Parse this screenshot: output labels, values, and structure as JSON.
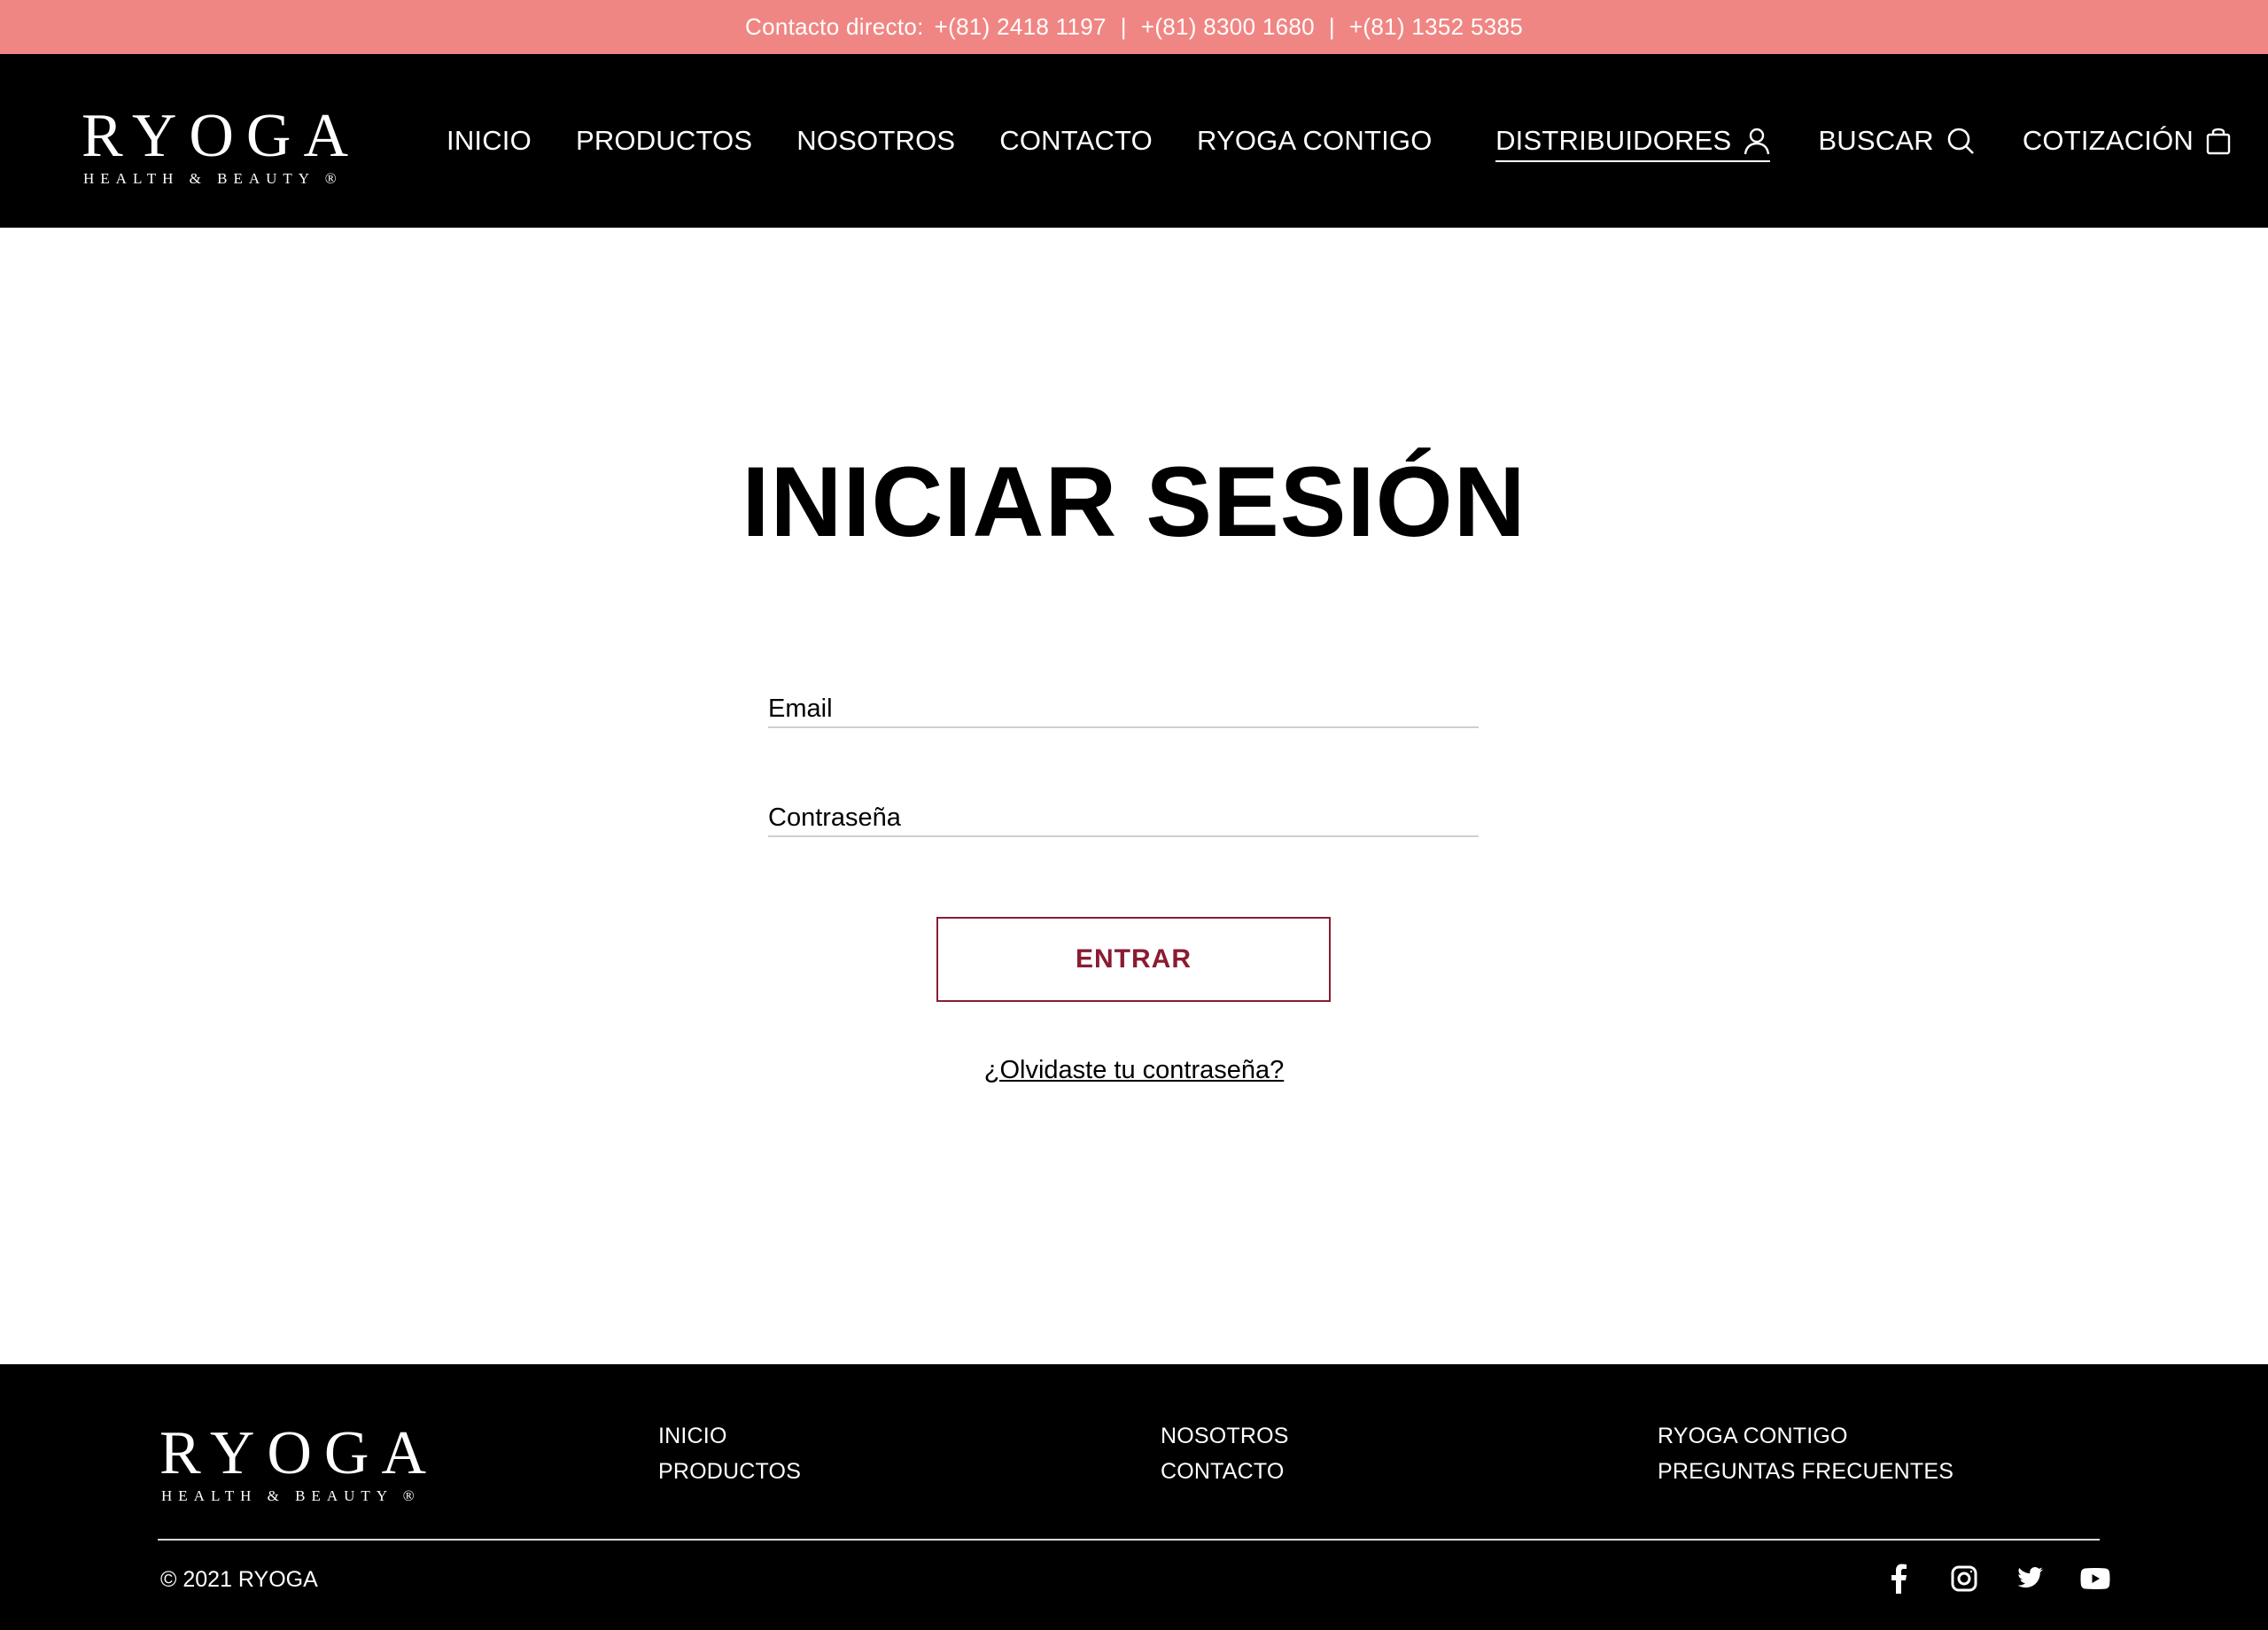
{
  "topbar": {
    "label": "Contacto directo:",
    "phones": [
      "+(81) 2418 1197",
      "+(81) 8300 1680",
      "+(81) 1352 5385"
    ],
    "separator": "|",
    "bg_color": "#f08683"
  },
  "header": {
    "logo_word": "RYOGA",
    "logo_sub": "HEALTH & BEAUTY ®",
    "nav": [
      "INICIO",
      "PRODUCTOS",
      "NOSOTROS",
      "CONTACTO",
      "RYOGA CONTIGO"
    ],
    "distribuidores": "DISTRIBUIDORES",
    "buscar": "BUSCAR",
    "cotizacion": "COTIZACIÓN",
    "icons": {
      "distribuidores": "user-icon",
      "buscar": "search-icon",
      "cotizacion": "bag-icon"
    }
  },
  "login": {
    "title": "INICIAR SESIÓN",
    "email_placeholder": "Email",
    "password_placeholder": "Contraseña",
    "submit_label": "ENTRAR",
    "forgot_label": "¿Olvidaste tu contraseña?",
    "accent_color": "#8a1c33"
  },
  "footer": {
    "logo_word": "RYOGA",
    "logo_sub": "HEALTH & BEAUTY ®",
    "col1": [
      "INICIO",
      "PRODUCTOS"
    ],
    "col2": [
      "NOSOTROS",
      "CONTACTO"
    ],
    "col3": [
      "RYOGA CONTIGO",
      "PREGUNTAS FRECUENTES"
    ],
    "copyright": "© 2021 RYOGA",
    "social": [
      "facebook-icon",
      "instagram-icon",
      "twitter-icon",
      "youtube-icon"
    ]
  }
}
